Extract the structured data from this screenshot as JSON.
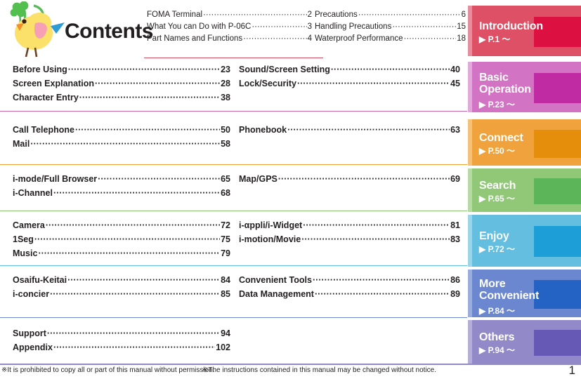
{
  "header": {
    "title": "Contents",
    "logo_icon": "chick-with-clover-logo",
    "columns": [
      {
        "entries": [
          {
            "title": "FOMA Terminal",
            "page": "2"
          },
          {
            "title": "What You can Do with P-06C",
            "page": "3"
          },
          {
            "title": "Part Names and Functions",
            "page": "4"
          }
        ]
      },
      {
        "entries": [
          {
            "title": "Precautions",
            "page": "6"
          },
          {
            "title": "Handling Precautions",
            "page": "15"
          },
          {
            "title": "Waterproof Performance",
            "page": "18"
          }
        ]
      }
    ]
  },
  "sections": [
    {
      "tab_label": "Introduction",
      "tab_page": "▶ P.1 ～",
      "color": "#dd5065",
      "edge_color": "#e88d9b",
      "square_color": "#dd1141",
      "columns": [
        {
          "entries": []
        },
        {
          "entries": []
        }
      ],
      "divider_color": "#d24a5e"
    },
    {
      "tab_label": "Basic Operation",
      "tab_page": "▶ P.23 ～",
      "color": "#d274c3",
      "edge_color": "#e3a8da",
      "square_color": "#c02ba3",
      "columns": [
        {
          "entries": [
            {
              "title": "Before Using",
              "page": "23"
            },
            {
              "title": "Screen Explanation",
              "page": "28"
            },
            {
              "title": "Character Entry",
              "page": "38"
            }
          ]
        },
        {
          "entries": [
            {
              "title": "Sound/Screen Setting",
              "page": "40"
            },
            {
              "title": "Lock/Security",
              "page": "45"
            }
          ]
        }
      ],
      "divider_color": "#c866bb"
    },
    {
      "tab_label": "Connect",
      "tab_page": "▶ P.50 ～",
      "color": "#f0a33c",
      "edge_color": "#f5c078",
      "square_color": "#e58e0b",
      "columns": [
        {
          "entries": [
            {
              "title": "Call Telephone",
              "page": "50"
            },
            {
              "title": "Mail",
              "page": "58"
            }
          ]
        },
        {
          "entries": [
            {
              "title": "Phonebook",
              "page": "63"
            }
          ]
        }
      ],
      "divider_color": "#eda233"
    },
    {
      "tab_label": "Search",
      "tab_page": "▶ P.65 ～",
      "color": "#90c878",
      "edge_color": "#b5daa4",
      "square_color": "#5cb558",
      "columns": [
        {
          "entries": [
            {
              "title": "i-mode/Full Browser",
              "page": "65"
            },
            {
              "title": "i-Channel",
              "page": "68"
            }
          ]
        },
        {
          "entries": [
            {
              "title": "Map/GPS",
              "page": "69"
            }
          ]
        }
      ],
      "divider_color": "#8cc677"
    },
    {
      "tab_label": "Enjoy",
      "tab_page": "▶ P.72 ～",
      "color": "#63bee0",
      "edge_color": "#9ad5e9",
      "square_color": "#1e9ed6",
      "columns": [
        {
          "entries": [
            {
              "title": "Camera",
              "page": "72"
            },
            {
              "title": "1Seg",
              "page": "75"
            },
            {
              "title": "Music",
              "page": "79"
            }
          ]
        },
        {
          "entries": [
            {
              "title": "i-αppli/i-Widget",
              "page": "81"
            },
            {
              "title": "i-motion/Movie",
              "page": "83"
            }
          ]
        }
      ],
      "divider_color": "#5fbcde"
    },
    {
      "tab_label": "More Convenient",
      "tab_page": "▶ P.84 ～",
      "color": "#6b87cf",
      "edge_color": "#9aaede",
      "square_color": "#2462c4",
      "columns": [
        {
          "entries": [
            {
              "title": "Osaifu-Keitai",
              "page": "84"
            },
            {
              "title": "i-concier",
              "page": "85"
            }
          ]
        },
        {
          "entries": [
            {
              "title": "Convenient Tools",
              "page": "86"
            },
            {
              "title": "Data Management",
              "page": "89"
            }
          ]
        }
      ],
      "divider_color": "#6b87cf"
    },
    {
      "tab_label": "Others",
      "tab_page": "▶ P.94 ～",
      "color": "#9289c8",
      "edge_color": "#b5aed9",
      "square_color": "#6659b5",
      "columns": [
        {
          "entries": [
            {
              "title": "Support",
              "page": "94"
            },
            {
              "title": "Appendix",
              "page": "102"
            }
          ]
        },
        {
          "entries": []
        }
      ],
      "divider_color": "#9289c8"
    }
  ],
  "footer": {
    "note_left": "※It is prohibited to copy all or part of this manual without permission.",
    "note_right": "※The instructions contained in this manual may be changed without notice.",
    "page_number": "1",
    "rule_color": "#9289c8"
  }
}
